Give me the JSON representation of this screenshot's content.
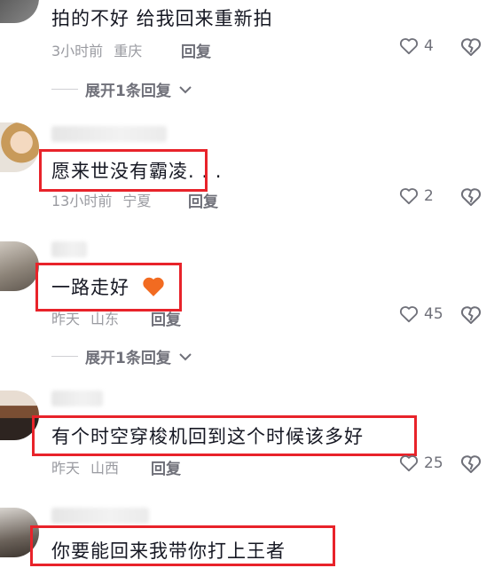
{
  "comments": [
    {
      "text": "拍的不好 给我回来重新拍",
      "time": "3小时前",
      "location": "重庆",
      "reply_label": "回复",
      "likes": "4",
      "expand_label": "展开1条回复"
    },
    {
      "text": "愿来世没有霸凌. . .",
      "time": "13小时前",
      "location": "宁夏",
      "reply_label": "回复",
      "likes": "2",
      "highlighted": true
    },
    {
      "text": "一路走好",
      "emoji": "orange-heart",
      "time": "昨天",
      "location": "山东",
      "reply_label": "回复",
      "likes": "45",
      "expand_label": "展开1条回复",
      "highlighted": true
    },
    {
      "text": "有个时空穿梭机回到这个时候该多好",
      "time": "昨天",
      "location": "山西",
      "reply_label": "回复",
      "likes": "25",
      "highlighted": true
    },
    {
      "text": "你要能回来我带你打上王者",
      "highlighted": true
    }
  ],
  "icons": {
    "like": "heart-outline-icon",
    "dislike": "broken-heart-icon",
    "expand": "chevron-down-icon"
  },
  "colors": {
    "highlight_box": "#e8232a",
    "meta_text": "#9a9ba1",
    "action_text": "#6f7079",
    "heart_emoji": "#f26b21"
  }
}
